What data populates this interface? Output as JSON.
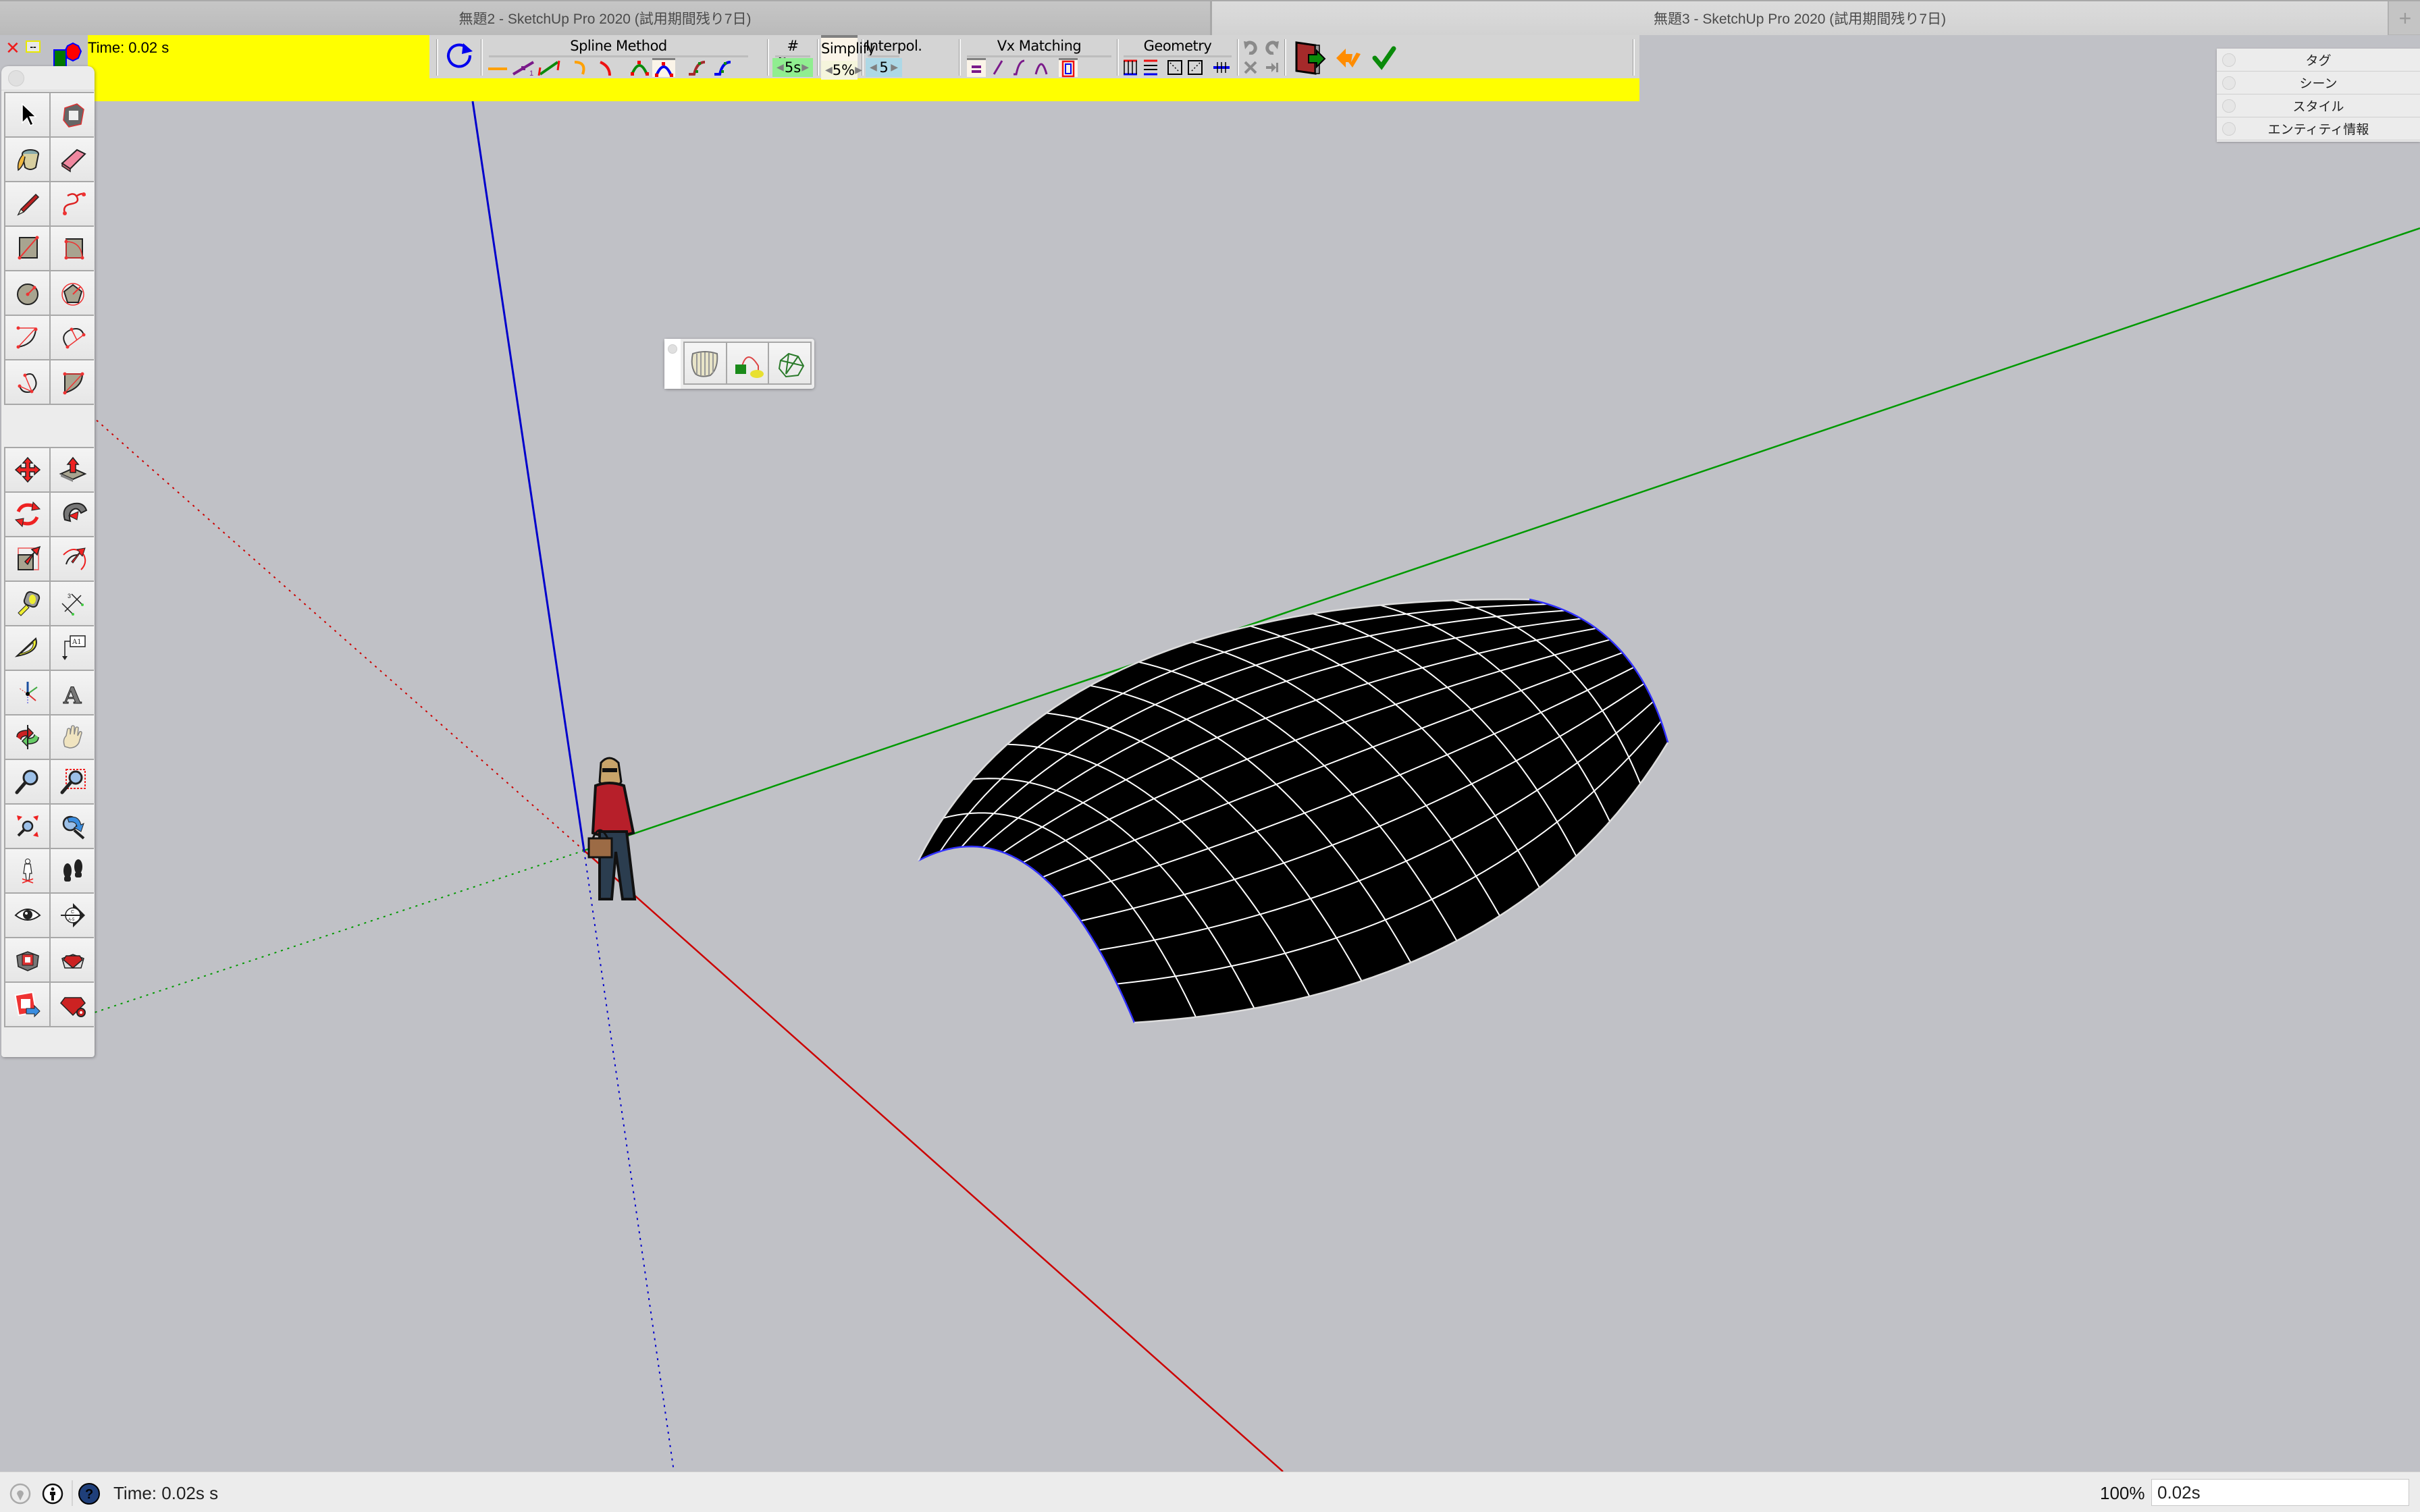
{
  "window": {
    "tabs": [
      {
        "title": "無題2 - SketchUp Pro 2020 (試用期間残り7日)",
        "active": true
      },
      {
        "title": "無題3 - SketchUp Pro 2020 (試用期間残り7日)",
        "active": false
      }
    ],
    "new_tab_label": "+"
  },
  "spline_toolbar": {
    "close_glyph": "✕",
    "minimize_label": "--",
    "time_label": "Time: 0.02 s",
    "bg_color": "#ffff00",
    "groups": {
      "spline_method": "Spline Method",
      "segments": "# Seg.",
      "simplify": "Simplify",
      "interpol": "Interpol.",
      "vx_matching": "Vx Matching",
      "geometry": "Geometry"
    },
    "segments_value": "5s",
    "simplify_value": "5%",
    "interpol_value": "5",
    "segments_color": "#90ee90",
    "simplify_color": "#f5f5dc",
    "interpol_color": "#add8e6",
    "spin_left": "◀",
    "spin_right": "▶",
    "icons": [
      "refresh-circle-icon",
      "polyline-icon",
      "polyline-1-icon",
      "polyline-segments-icon",
      "arc-orange-icon",
      "arc-red-icon",
      "bezier-green-icon",
      "bezier-blue-icon",
      "s-curve-brown-icon",
      "s-curve-blue-icon",
      "vx-equal-icon",
      "vx-line-icon",
      "vx-scurve-icon",
      "vx-arc-icon",
      "vx-frame-icon",
      "geometry-columns-icon",
      "geometry-rows-icon",
      "geometry-diag1-icon",
      "geometry-diag2-icon",
      "geometry-cross-icon",
      "undo-icon",
      "redo-icon",
      "cancel-icon",
      "jump-end-icon",
      "exit-door-icon",
      "restore-icon",
      "validate-check-icon"
    ]
  },
  "tray": {
    "items": [
      {
        "label": "タグ"
      },
      {
        "label": "シーン"
      },
      {
        "label": "スタイル"
      },
      {
        "label": "エンティティ情報"
      }
    ]
  },
  "palette": {
    "groups": [
      [
        "select-tool",
        "make-component-tool",
        "paint-bucket-tool",
        "eraser-tool"
      ],
      [
        "line-tool",
        "freehand-tool",
        "rectangle-tool",
        "rotated-rectangle-tool",
        "circle-tool",
        "polygon-tool",
        "arc-tool",
        "two-point-arc-tool",
        "three-point-arc-tool",
        "pie-tool"
      ],
      [
        "move-tool",
        "push-pull-tool",
        "rotate-tool",
        "follow-me-tool",
        "scale-tool",
        "offset-tool"
      ],
      [
        "tape-measure-tool",
        "dimension-tool",
        "protractor-tool",
        "text-tool",
        "axes-tool",
        "3d-text-tool"
      ],
      [
        "orbit-tool",
        "pan-tool",
        "zoom-tool",
        "zoom-window-tool",
        "zoom-extents-tool",
        "previous-view-tool"
      ],
      [
        "position-camera-tool",
        "walk-tool",
        "look-around-tool",
        "section-plane-tool"
      ],
      [
        "3d-warehouse-tool",
        "extension-warehouse-tool",
        "layout-send-tool",
        "extension-manager-tool"
      ]
    ]
  },
  "mini_toolbar": {
    "buttons": [
      "curviloft-skin-icon",
      "curviloft-loft-path-icon",
      "curviloft-loft-icon"
    ]
  },
  "scene": {
    "axis_colors": {
      "red": "#cc0000",
      "green": "#009900",
      "blue": "#0000cc"
    },
    "surface_color": "#000000",
    "grid_color": "#ffffff",
    "background": "#c0c1c6"
  },
  "statusbar": {
    "message": "Time: 0.02s s",
    "zoom_label": "100%",
    "vcb_value": "0.02s",
    "icons": [
      "geolocation-icon",
      "credits-icon",
      "help-icon"
    ]
  }
}
